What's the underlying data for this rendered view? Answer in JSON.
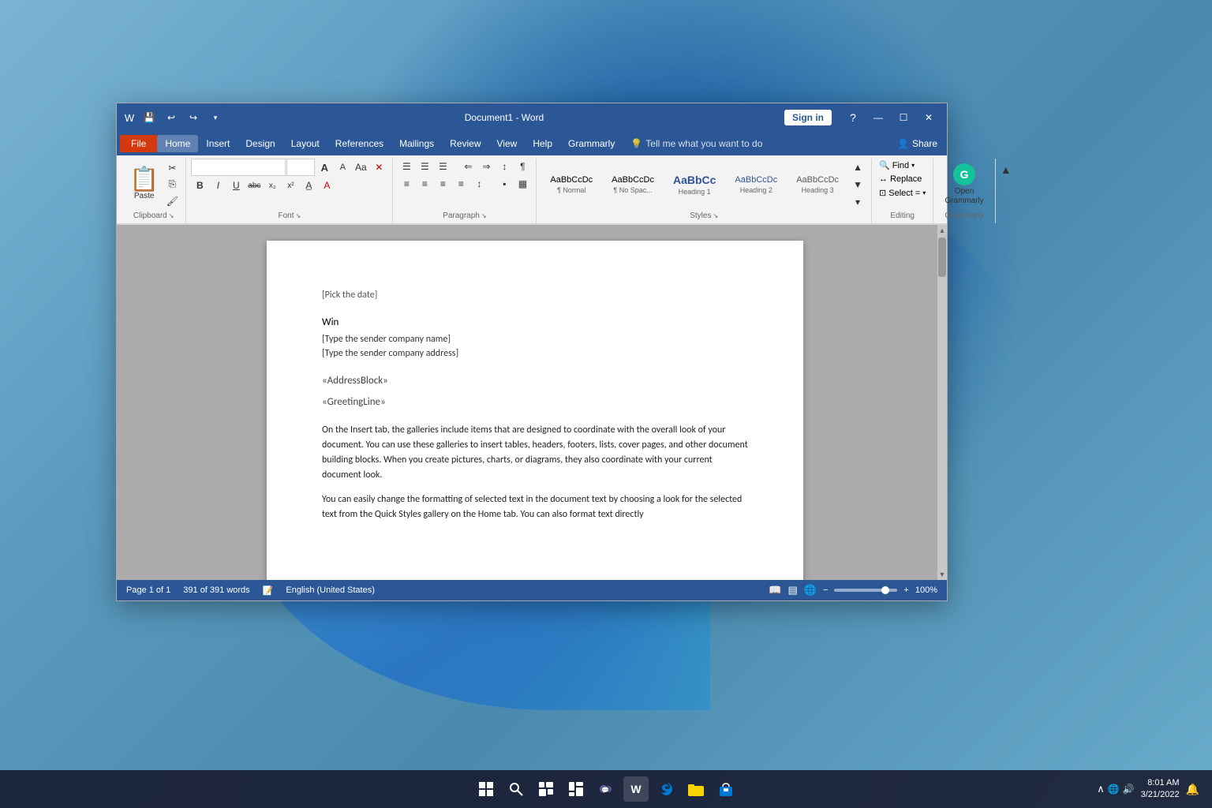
{
  "window": {
    "title": "Document1 - Word",
    "signin": "Sign in"
  },
  "titlebar": {
    "save": "💾",
    "undo": "↩",
    "redo": "↪",
    "customize": "▾"
  },
  "menu": {
    "file": "File",
    "home": "Home",
    "insert": "Insert",
    "design": "Design",
    "layout": "Layout",
    "references": "References",
    "mailings": "Mailings",
    "review": "Review",
    "view": "View",
    "help": "Help",
    "grammarly": "Grammarly",
    "tellme": "Tell me what you want to do",
    "share": "Share"
  },
  "ribbon": {
    "clipboard": {
      "label": "Clipboard",
      "paste": "Paste",
      "cut": "✂",
      "copy": "📋",
      "formatpaint": "🖌"
    },
    "font": {
      "label": "Font",
      "name": "",
      "size": "",
      "grow": "A",
      "shrink": "A",
      "case": "Aa",
      "clear": "✕",
      "bold": "B",
      "italic": "I",
      "underline": "U",
      "strikethrough": "abc",
      "subscript": "x₂",
      "superscript": "x²",
      "highlight": "A",
      "fontcolor": "A"
    },
    "paragraph": {
      "label": "Paragraph",
      "bullets": "≡",
      "numbering": "≡",
      "multilevel": "≡",
      "decreaseindent": "←",
      "increaseindent": "→",
      "sort": "↕",
      "showmarks": "¶",
      "alignleft": "≡",
      "center": "≡",
      "alignright": "≡",
      "justify": "≡",
      "linespacing": "↕",
      "shading": "▪",
      "borders": "▦"
    },
    "styles": {
      "label": "Styles",
      "normal": {
        "preview": "AaBbCcDc",
        "label": "¶ Normal"
      },
      "nospace": {
        "preview": "AaBbCcDc",
        "label": "¶ No Spac..."
      },
      "heading1": {
        "preview": "AaBbCc",
        "label": "Heading 1"
      },
      "heading2": {
        "preview": "AaBbCcDc",
        "label": "Heading 2"
      },
      "heading3": {
        "preview": "AaBbCcDc",
        "label": "Heading 3"
      }
    },
    "editing": {
      "label": "Editing",
      "find": "Find",
      "replace": "Replace",
      "select": "Select ="
    },
    "grammarly": {
      "label": "Grammarly",
      "openLabel": "Open\nGrammarly"
    }
  },
  "document": {
    "date": "[Pick the date]",
    "name": "Win",
    "companyname": "[Type the sender company name]",
    "companyaddress": "[Type the sender company address]",
    "addressblock": "«AddressBlock»",
    "greetingline": "«GreetingLine»",
    "para1": "On the Insert tab, the galleries include items that are designed to coordinate with the overall look of your document. You can use these galleries to insert tables, headers, footers, lists, cover pages, and other document building blocks. When you create pictures, charts, or diagrams, they also coordinate with your current document look.",
    "para2": "You can easily change the formatting of selected text in the document text by choosing a look for the selected text from the Quick Styles gallery on the Home tab. You can also format text directly"
  },
  "statusbar": {
    "page": "Page 1 of 1",
    "words": "391 of 391 words",
    "language": "English (United States)",
    "zoom": "100%"
  },
  "taskbar": {
    "time": "8:01 AM",
    "date": "3/21/2022",
    "start": "⊞",
    "search": "🔍",
    "taskview": "⧉",
    "widgets": "▦",
    "chat": "💬",
    "edge": "🌐",
    "explorer": "📁",
    "store": "🛍"
  }
}
